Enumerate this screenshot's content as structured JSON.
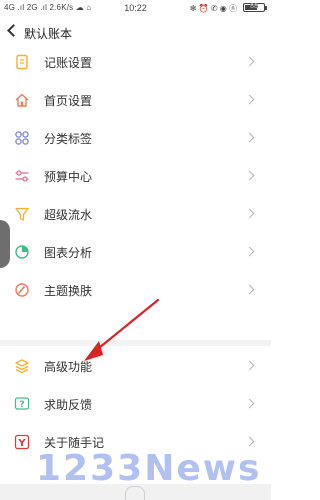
{
  "status_bar": {
    "signal": "4G .ıl 2G .ıl 2.6K/s ☁ ⌂",
    "time": "10:22",
    "indicators": "✻ ⏰ ✆ ◉ ⓝ",
    "battery": "88"
  },
  "header": {
    "title": "默认账本",
    "back_icon": "chevron-left-icon"
  },
  "menu": [
    {
      "label": "记账设置",
      "icon": "notebook-icon",
      "color": "#f5b12a"
    },
    {
      "label": "首页设置",
      "icon": "home-icon",
      "color": "#f2795b"
    },
    {
      "label": "分类标签",
      "icon": "grid-icon",
      "color": "#7a7fe0"
    },
    {
      "label": "预算中心",
      "icon": "sliders-icon",
      "color": "#ef6d8c"
    },
    {
      "label": "超级流水",
      "icon": "funnel-icon",
      "color": "#f5b12a"
    },
    {
      "label": "图表分析",
      "icon": "pie-chart-icon",
      "color": "#3cbf8a"
    },
    {
      "label": "主题换肤",
      "icon": "palette-icon",
      "color": "#f2795b"
    },
    {
      "label": "高级功能",
      "icon": "layers-icon",
      "color": "#f5b12a"
    },
    {
      "label": "求助反馈",
      "icon": "help-icon",
      "color": "#3cbf8a"
    },
    {
      "label": "关于随手记",
      "icon": "logo-icon",
      "color": "#e53935"
    }
  ],
  "watermark": "1233News",
  "colors": {
    "arrow": "#e02020",
    "divider": "#f3f3f3"
  }
}
